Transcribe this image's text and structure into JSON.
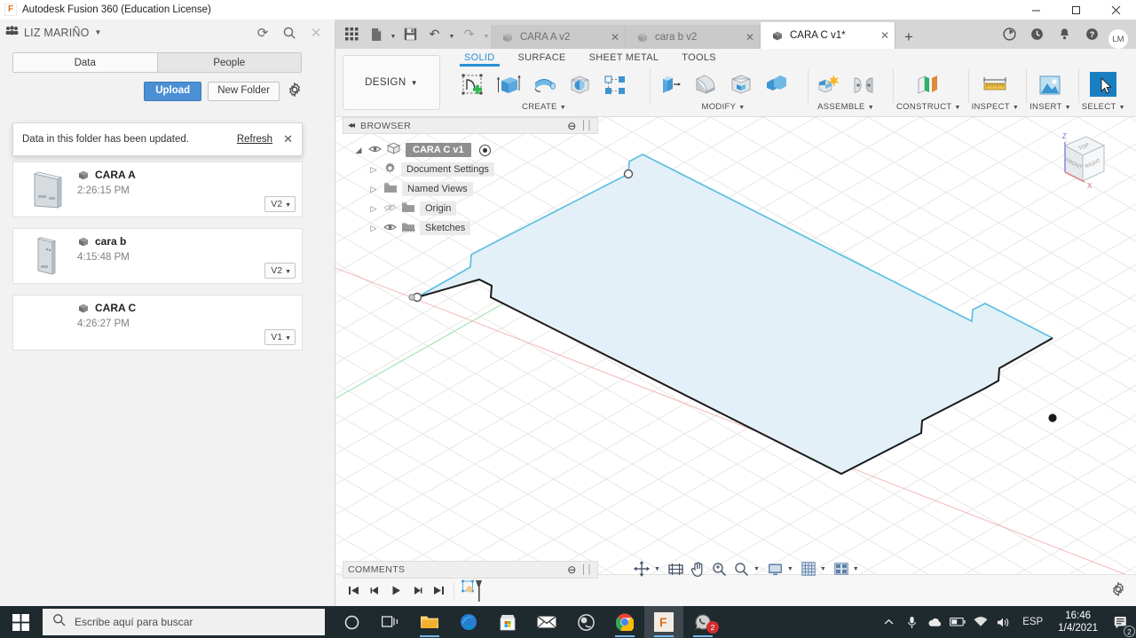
{
  "window": {
    "app_title": "Autodesk Fusion 360 (Education License)",
    "app_icon": "F",
    "minimize": "─",
    "maximize": "☐",
    "close": "✕"
  },
  "data_panel": {
    "user_name": "LIZ MARIÑO",
    "user_caret": "▼",
    "people_icon": "people-icon",
    "refresh_icon": "⟳",
    "search_icon": "⌕",
    "close_icon": "✕",
    "tabs": [
      {
        "label": "Data",
        "active": true
      },
      {
        "label": "People",
        "active": false
      }
    ],
    "upload_label": "Upload",
    "new_folder_label": "New Folder",
    "gear_icon": "⚙",
    "notification": {
      "message": "Data in this folder has been updated.",
      "refresh_label": "Refresh",
      "close_icon": "✕"
    },
    "files": [
      {
        "name": "CARA A",
        "time": "2:26:15 PM",
        "version": "V2"
      },
      {
        "name": "cara b",
        "time": "4:15:48 PM",
        "version": "V2"
      },
      {
        "name": "CARA C",
        "time": "4:26:27 PM",
        "version": "V1"
      }
    ],
    "version_caret": "▼"
  },
  "fusion": {
    "quick_access": {
      "grid_icon": "grid-icon",
      "new_icon": "new-file-icon",
      "save_icon": "save-icon",
      "undo_icon": "↶",
      "redo_icon": "↷",
      "caret": "▼"
    },
    "document_tabs": [
      {
        "label": "CARA A v2",
        "active": false,
        "close": "✕"
      },
      {
        "label": "cara b v2",
        "active": false,
        "close": "✕"
      },
      {
        "label": "CARA C v1*",
        "active": true,
        "close": "✕"
      }
    ],
    "new_tab_icon": "+",
    "header_icons": [
      "job-status-icon",
      "recent-icon",
      "notifications-icon",
      "help-icon"
    ],
    "avatar_initials": "LM",
    "design_label": "DESIGN",
    "design_caret": "▼",
    "workspace_tabs": [
      {
        "label": "SOLID",
        "active": true
      },
      {
        "label": "SURFACE",
        "active": false
      },
      {
        "label": "SHEET METAL",
        "active": false
      },
      {
        "label": "TOOLS",
        "active": false
      }
    ],
    "panels": [
      {
        "label": "CREATE",
        "caret": "▼",
        "tools": [
          "create-sketch",
          "extrude",
          "revolve",
          "sphere",
          "pattern"
        ]
      },
      {
        "label": "MODIFY",
        "caret": "▼",
        "tools": [
          "press-pull",
          "fillet",
          "shell",
          "combine"
        ]
      },
      {
        "label": "ASSEMBLE",
        "caret": "▼",
        "tools": [
          "new-component",
          "joint"
        ]
      },
      {
        "label": "CONSTRUCT",
        "caret": "▼",
        "tools": [
          "offset-plane"
        ]
      },
      {
        "label": "INSPECT",
        "caret": "▼",
        "tools": [
          "measure"
        ]
      },
      {
        "label": "INSERT",
        "caret": "▼",
        "tools": [
          "insert-image"
        ]
      },
      {
        "label": "SELECT",
        "caret": "▼",
        "tools": [
          "select-cursor"
        ]
      }
    ],
    "browser": {
      "title": "BROWSER",
      "collapse_icon": "◂◂",
      "panel_dot": "⊖",
      "grip_icon": "││",
      "nodes": [
        {
          "label": "CARA C v1",
          "root": true,
          "eye": true,
          "radio": true,
          "tri": "◢"
        },
        {
          "label": "Document Settings",
          "icon": "gear-icon",
          "tri": "▷"
        },
        {
          "label": "Named Views",
          "icon": "folder-icon",
          "tri": "▷"
        },
        {
          "label": "Origin",
          "icon": "folder-icon",
          "tri": "▷",
          "eye": false
        },
        {
          "label": "Sketches",
          "icon": "sketches-icon",
          "tri": "▷",
          "eye": true
        }
      ]
    },
    "comments": {
      "title": "COMMENTS",
      "panel_dot": "⊖",
      "grip_icon": "││"
    },
    "nav_bar": [
      {
        "name": "orbit-icon",
        "glyph": "✤",
        "caret": "▼"
      },
      {
        "name": "look-at-icon",
        "glyph": "⛶",
        "caret": ""
      },
      {
        "name": "pan-icon",
        "glyph": "✋",
        "caret": ""
      },
      {
        "name": "zoom-icon",
        "glyph": "⚲",
        "caret": ""
      },
      {
        "name": "fit-icon",
        "glyph": "⚲",
        "caret": "▼"
      },
      {
        "name": "display-settings-icon",
        "glyph": "▣",
        "caret": "▼"
      },
      {
        "name": "grid-snaps-icon",
        "glyph": "⌗",
        "caret": "▼"
      },
      {
        "name": "viewports-icon",
        "glyph": "▦",
        "caret": "▼"
      }
    ],
    "view_cube": {
      "top_label": "TOP",
      "front_label": "FRONT",
      "right_label": "RIGHT",
      "z_axis": "Z",
      "x_axis": "X"
    },
    "timeline": {
      "buttons": [
        "⏮",
        "◀",
        "▶",
        "▷",
        "⏭"
      ],
      "feature_name": "sketch-feature",
      "settings_icon": "⚙"
    }
  },
  "taskbar": {
    "start_icon": "windows-logo",
    "search_placeholder": "Escribe aquí para buscar",
    "search_icon": "⌕",
    "items": [
      {
        "name": "cortana-icon",
        "glyph": "◯"
      },
      {
        "name": "task-view-icon",
        "glyph": "⧉"
      },
      {
        "name": "file-explorer-icon",
        "glyph": "folder"
      },
      {
        "name": "edge-icon",
        "glyph": "edge"
      },
      {
        "name": "microsoft-store-icon",
        "glyph": "store"
      },
      {
        "name": "mail-icon",
        "glyph": "mail"
      },
      {
        "name": "obs-icon",
        "glyph": "obs"
      },
      {
        "name": "chrome-icon",
        "glyph": "chrome"
      },
      {
        "name": "fusion360-icon",
        "glyph": "F"
      },
      {
        "name": "whatsapp-icon",
        "glyph": "whatsapp",
        "badge": "2"
      }
    ],
    "tray": {
      "chevron": "∧",
      "mic_icon": "\u0001",
      "onedrive_icon": "☁",
      "battery_icon": "▭",
      "wifi_icon": "◠",
      "volume_icon": "ᴘ",
      "language": "ESP",
      "time": "16:46",
      "date": "1/4/2021",
      "notification_badge": "2"
    }
  },
  "sketch": {
    "type": "2d-sketch-profile",
    "fill_color": "#e3f0f8",
    "active_edge_color": "#5ec0e0",
    "fixed_edge_color": "#1a1a1a",
    "grid_color": "#e6e6e6"
  }
}
